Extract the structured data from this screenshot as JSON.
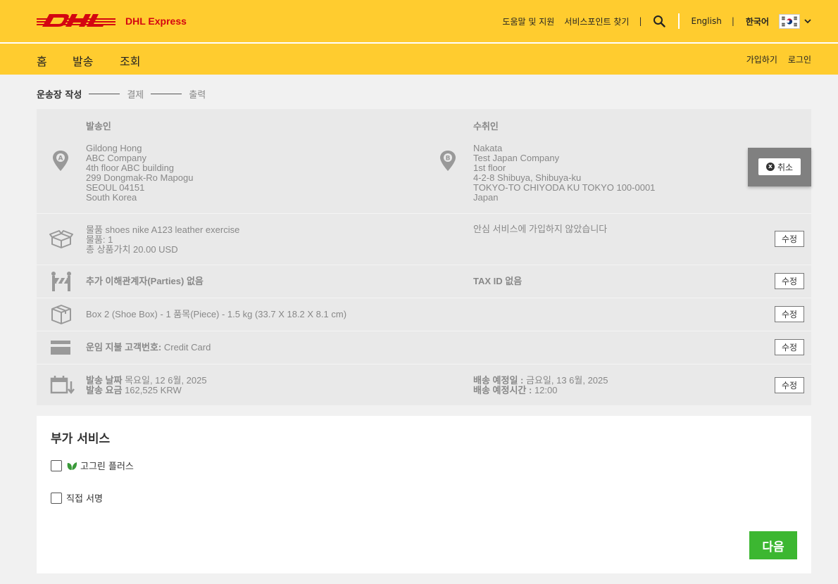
{
  "header": {
    "brand": "DHL Express",
    "help_link": "도움말 및 지원",
    "service_point_link": "서비스포인트 찾기",
    "sep": "|",
    "lang_english": "English",
    "lang_korean": "한국어",
    "brand_color": "#d40511",
    "accent_color": "#ffcc2f"
  },
  "nav": {
    "items": [
      "홈",
      "발송",
      "조회"
    ],
    "signup": "가입하기",
    "login": "로그인"
  },
  "steps": {
    "step1": "운송장 작성",
    "step2": "결제",
    "step3": "출력"
  },
  "summary": {
    "sender_header": "발송인",
    "receiver_header": "수취인",
    "sender_lines": [
      "Gildong Hong",
      "ABC Company",
      "4th floor ABC building",
      "299 Dongmak-Ro Mapogu",
      "SEOUL 04151",
      "South Korea"
    ],
    "receiver_lines": [
      "Nakata",
      "Test Japan Company",
      "1st floor",
      "4-2-8 Shibuya, Shibuya-ku",
      "TOKYO-TO CHIYODA KU TOKYO 100-0001",
      "Japan"
    ],
    "marker_a": "A",
    "marker_b": "B",
    "cancel_label": "취소",
    "cancel_icon": "x",
    "goods_line1": "물품 shoes nike A123 leather exercise",
    "goods_line2": "물품: 1",
    "goods_line3": "총 상품가치 20.00 USD",
    "insurance": "안심 서비스에 가입하지 않았습니다",
    "parties": "추가 이해관계자(Parties) 없음",
    "tax_id": "TAX ID 없음",
    "package": "Box 2 (Shoe Box) - 1 품목(Piece) - 1.5 kg (33.7 X 18.2 X 8.1 cm)",
    "payment_label": "운임 지불 고객번호:",
    "payment_value": "Credit Card",
    "ship_date_label": "발송 날짜",
    "ship_date_value": "목요일, 12 6월, 2025",
    "ship_fee_label": "발송 요금",
    "ship_fee_value": "162,525 KRW",
    "delivery_date_label": "배송 예정일 :",
    "delivery_date_value": "금요일, 13 6월, 2025",
    "delivery_time_label": "배송 예정시간 :",
    "delivery_time_value": "12:00",
    "edit_label": "수정"
  },
  "services": {
    "title": "부가 서비스",
    "gogreen_label": "고그린 플러스",
    "signature_label": "직접 서명",
    "next_label": "다음",
    "next_color": "#3cb731"
  }
}
